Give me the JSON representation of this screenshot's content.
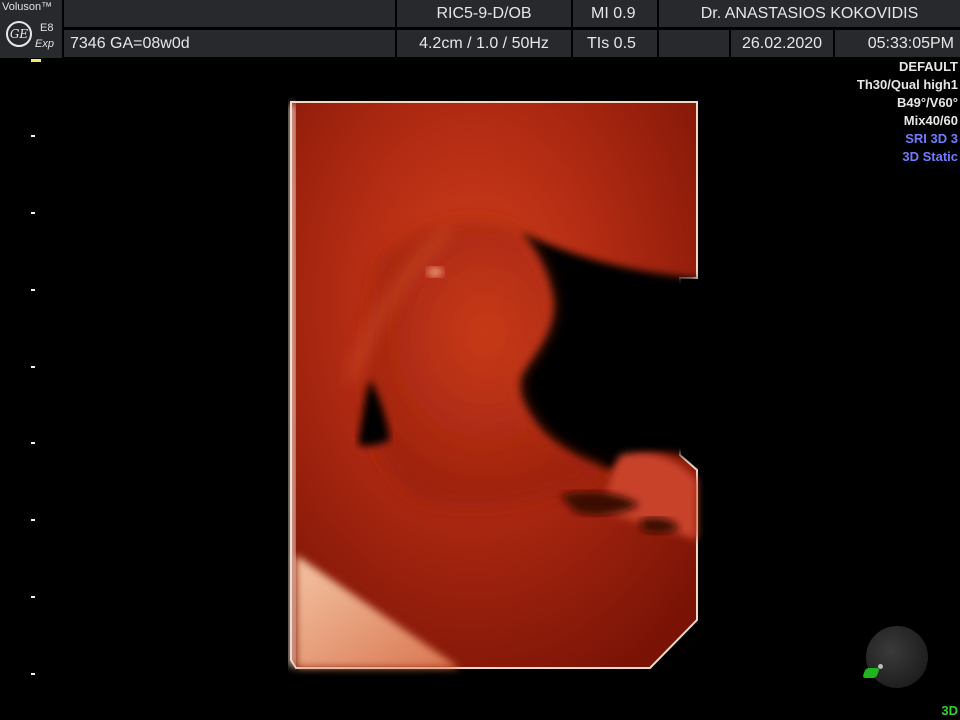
{
  "header": {
    "brand": "Voluson™",
    "logo_text": "GE",
    "model": "E8",
    "model_sub": "Exp",
    "patient_info": "7346  GA=08w0d",
    "probe": "RIC5-9-D/OB",
    "depth_params": "4.2cm / 1.0 / 50Hz",
    "mi": "MI  0.9",
    "tis": "TIs  0.5",
    "doctor": "Dr. ANASTASIOS KOKOVIDIS",
    "date": "26.02.2020",
    "time": "05:33:05PM"
  },
  "info_panel": {
    "preset": "DEFAULT",
    "threshold": "Th30/Qual high1",
    "angles": "B49°/V60°",
    "mix": "Mix40/60",
    "sri": "SRI 3D 3",
    "mode": "3D Static"
  },
  "footer": {
    "mode_label": "3D"
  },
  "colors": {
    "header_cell": "#27292d",
    "info_highlight": "#6f7cff",
    "render_tissue": "#b02a12",
    "indicator_green": "#1fb51f"
  },
  "icons": [
    "ge-logo-icon",
    "orientation-ball-icon"
  ]
}
